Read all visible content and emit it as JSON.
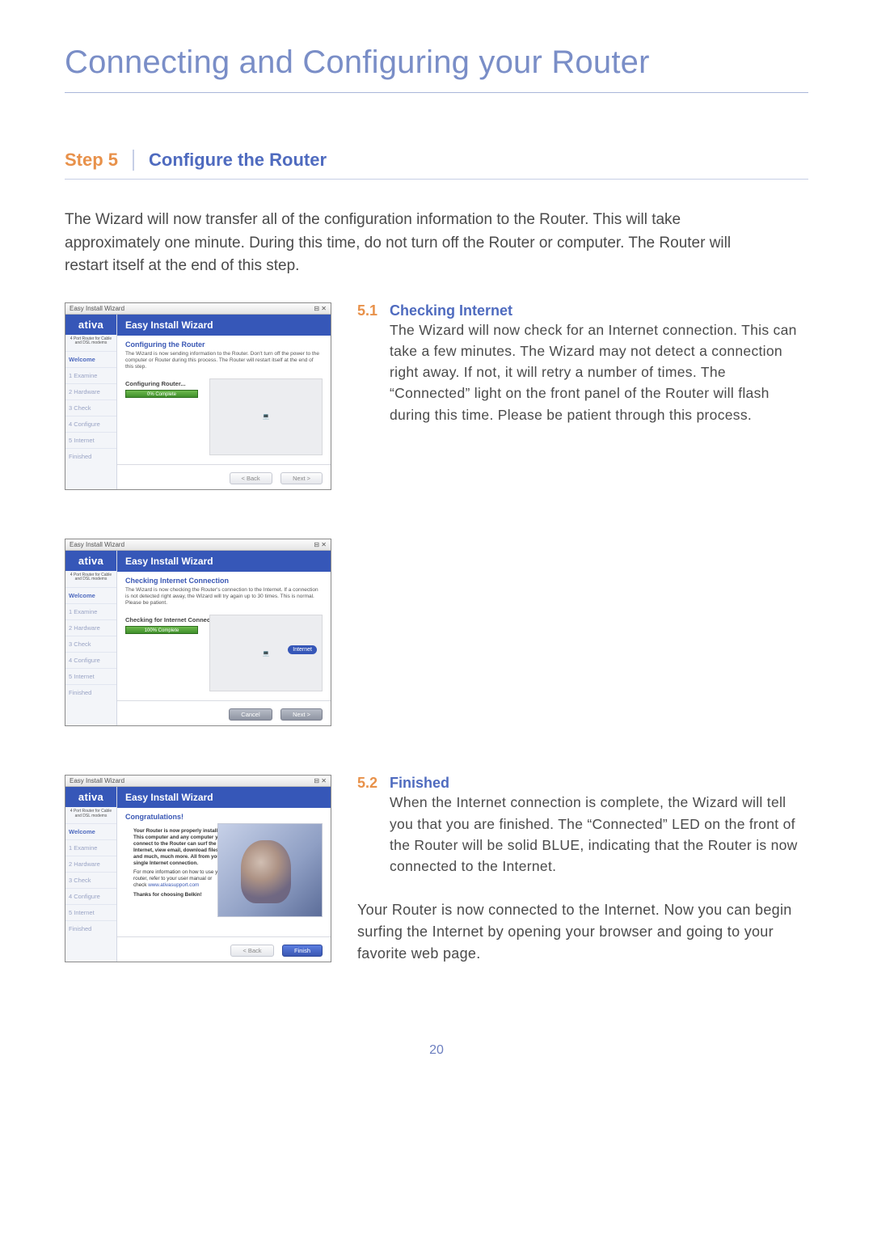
{
  "page_title": "Connecting and Configuring your Router",
  "step": {
    "number": "Step 5",
    "title": "Configure the Router"
  },
  "intro": "The Wizard will now transfer all of the configuration information to the Router. This will take approximately one minute. During this time, do not turn off the Router or computer. The Router will restart itself at the end of this step.",
  "sections": {
    "s51": {
      "num": "5.1",
      "title": "Checking Internet",
      "text": "The Wizard will now check for an Internet connection. This can take a few minutes. The Wizard may not detect a connection right away. If not, it will retry a number of times. The “Connected” light on the front panel of the Router will flash during this time. Please be patient through this process."
    },
    "s52": {
      "num": "5.2",
      "title": "Finished",
      "text": "When the Internet connection is complete, the Wizard will tell you that you are finished. The “Connected” LED on the front of the Router will be solid BLUE, indicating that the Router is now connected to the Internet."
    }
  },
  "closing": "Your Router is now connected to the Internet. Now you can begin surfing the Internet by opening your browser and going to your favorite web page.",
  "page_number": "20",
  "wizard": {
    "window_title": "Easy Install Wizard",
    "brand": "ativa",
    "brand_sub": "4 Port Router for Cable and DSL modems",
    "header": "Easy Install Wizard",
    "steps": [
      "Welcome",
      "1 Examine",
      "2 Hardware",
      "3 Check",
      "4 Configure",
      "5 Internet",
      "Finished"
    ],
    "shot1": {
      "subheader": "Configuring the Router",
      "desc": "The Wizard is now sending information to the Router. Don't turn off the power to the computer or Router during this process. The Router will restart itself at the end of this step.",
      "label": "Configuring Router...",
      "progress": "0% Complete",
      "btn_back": "< Back",
      "btn_next": "Next >"
    },
    "shot2": {
      "subheader": "Checking Internet Connection",
      "desc": "The Wizard is now checking the Router's connection to the Internet. If a connection is not detected right away, the Wizard will try again up to 30 times. This is normal. Please be patient.",
      "label": "Checking for Internet Connection...",
      "progress": "100% Complete",
      "tag": "Internet",
      "btn_cancel": "Cancel",
      "btn_next": "Next >"
    },
    "shot3": {
      "subheader": "Congratulations!",
      "line1": "Your Router is now properly installed. This computer and any computer you connect to the Router can surf the Internet, view email, download files and much, much more. All from your single Internet connection.",
      "line2a": "For more information on how to use your router, refer to your user manual or check ",
      "line2_link": "www.ativasupport.com",
      "line3": "Thanks for choosing Belkin!",
      "btn_back": "< Back",
      "btn_finish": "Finish"
    }
  }
}
